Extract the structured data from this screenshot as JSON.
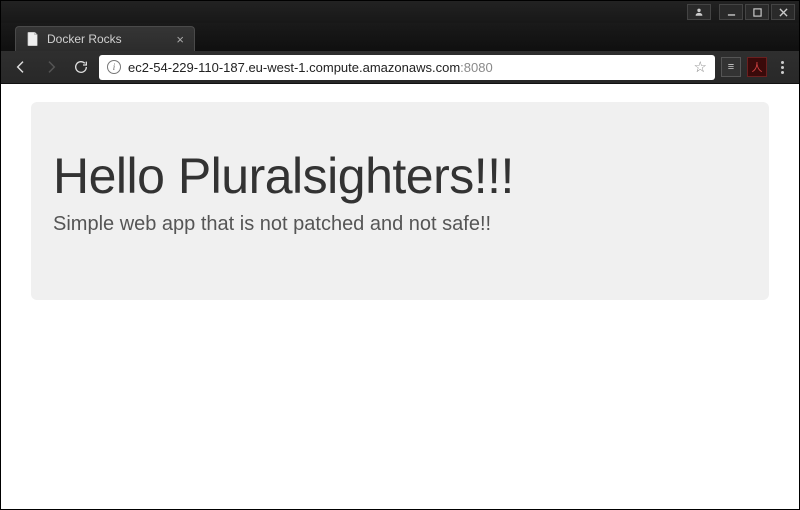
{
  "window": {
    "user_icon": "user"
  },
  "tab": {
    "title": "Docker Rocks"
  },
  "addressbar": {
    "info_glyph": "i",
    "url_host": "ec2-54-229-110-187.eu-west-1.compute.amazonaws.com",
    "url_port": ":8080"
  },
  "extensions": {
    "ext1_label": "≡",
    "ext2_label": "人"
  },
  "page": {
    "heading": "Hello Pluralsighters!!!",
    "subheading": "Simple web app that is not patched and not safe!!"
  }
}
